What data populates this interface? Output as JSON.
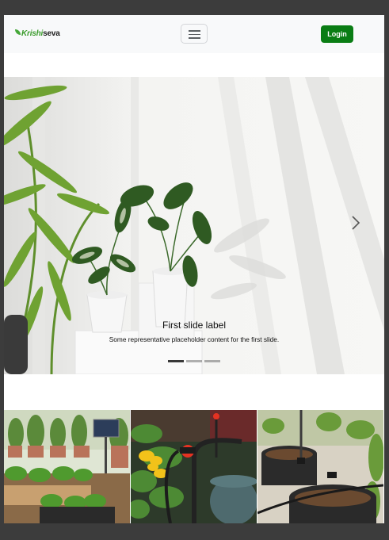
{
  "navbar": {
    "brand_part1": "Krishi",
    "brand_part2": "seva",
    "toggle_label": "Toggle navigation",
    "login_label": "Login"
  },
  "carousel": {
    "slides": [
      {
        "title": "First slide label",
        "text": "Some representative placeholder content for the first slide."
      }
    ],
    "active_index": 0,
    "indicator_count": 3,
    "next_label": "Next"
  },
  "gallery": {
    "tiles": [
      {
        "icon": "solar-panel-garden-icon"
      },
      {
        "icon": "drip-irrigation-flower-icon"
      },
      {
        "icon": "drip-irrigation-pots-icon"
      }
    ]
  },
  "colors": {
    "login_bg": "#0a7d14",
    "navbar_bg": "#f8f9fa",
    "outer_bg": "#3c3c3c"
  }
}
